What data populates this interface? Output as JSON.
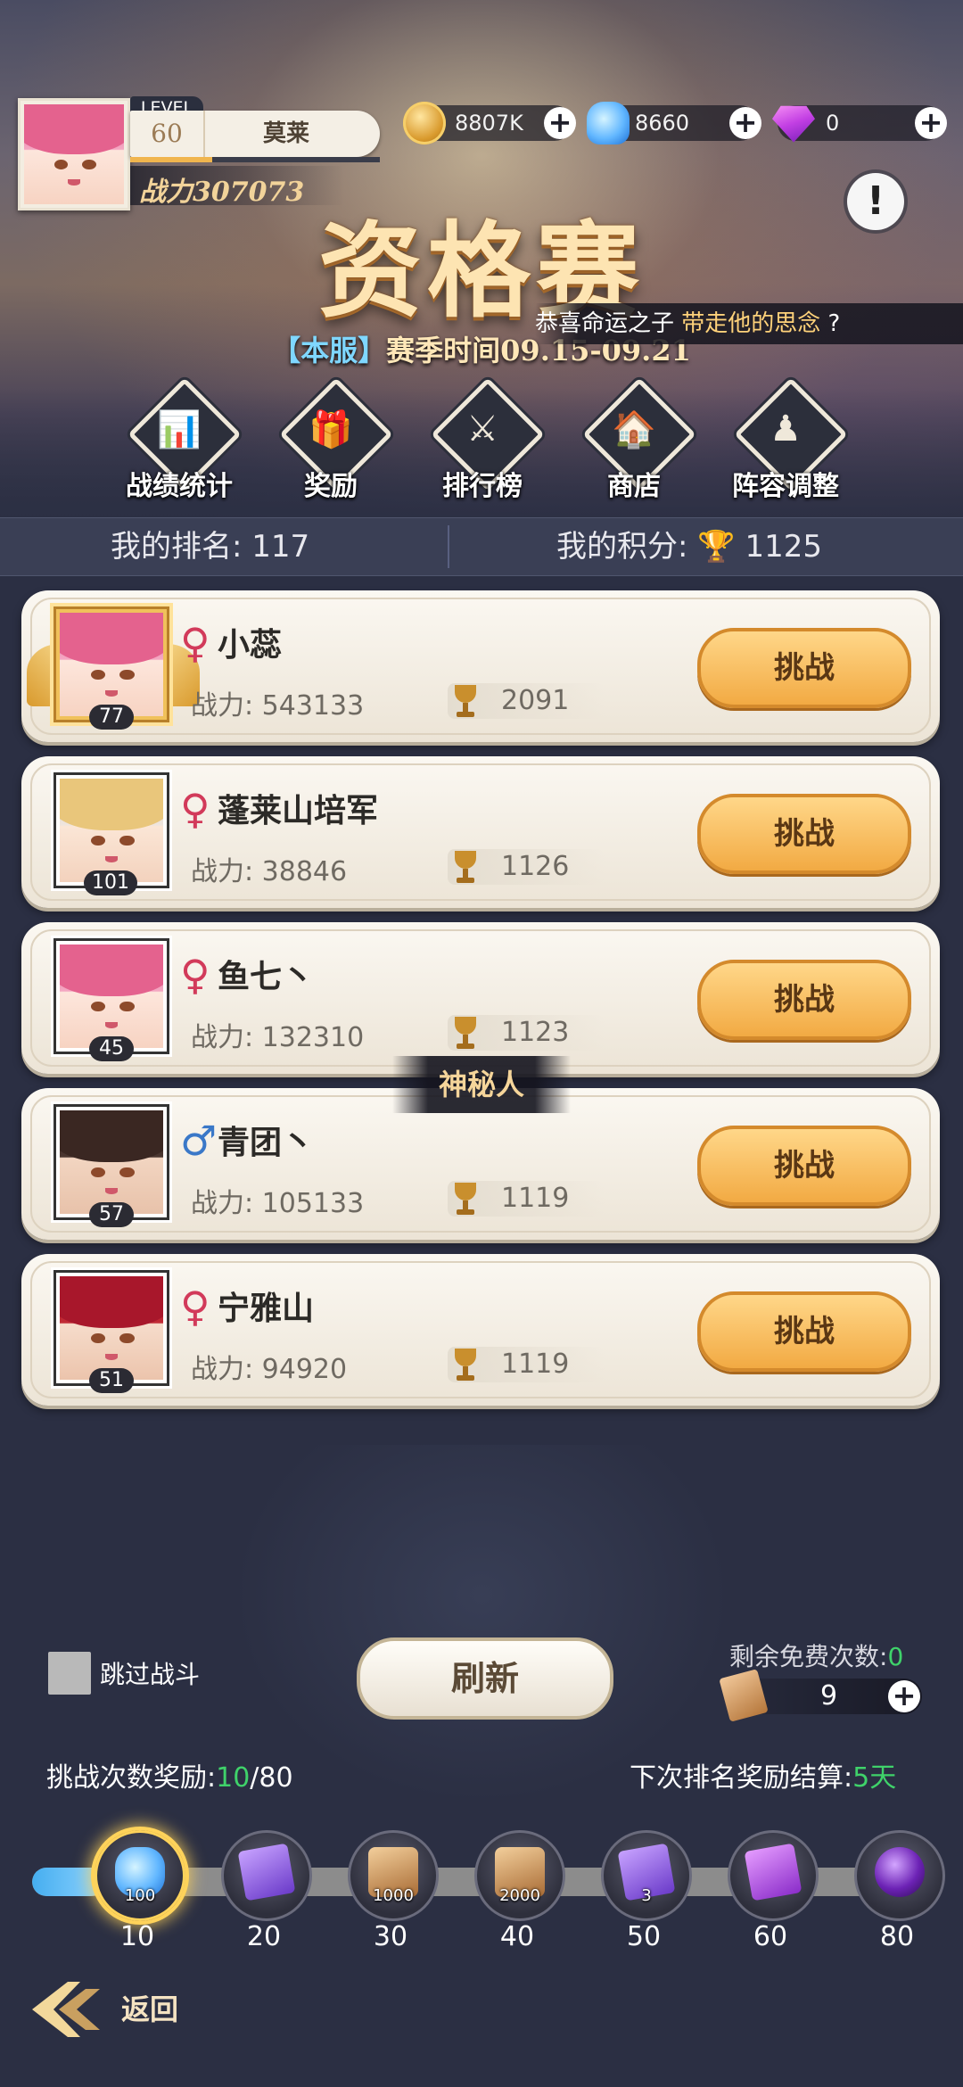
{
  "player": {
    "level_label": "LEVEL",
    "level": "60",
    "name": "莫莱",
    "exp_fraction": 0.33,
    "power": "战力307073"
  },
  "currencies": [
    {
      "icon": "gold-coin-icon",
      "value": "8807K"
    },
    {
      "icon": "blue-gem-icon",
      "value": "8660"
    },
    {
      "icon": "purple-diamond-icon",
      "value": "0"
    }
  ],
  "info_button": "!",
  "title": "资格赛",
  "season": {
    "tag": "【本服】",
    "text": "赛季时间09.15-09.21"
  },
  "marquee": {
    "prefix": "恭喜命运之子 ",
    "highlight": "带走他的思念 ",
    "suffix": "?"
  },
  "nav": [
    {
      "icon": "bar-chart-icon",
      "glyph": "📊",
      "label": "战绩统计"
    },
    {
      "icon": "gift-box-icon",
      "glyph": "🎁",
      "label": "奖励"
    },
    {
      "icon": "swords-icon",
      "glyph": "⚔",
      "label": "排行榜"
    },
    {
      "icon": "shop-icon",
      "glyph": "🏠",
      "label": "商店"
    },
    {
      "icon": "chess-pieces-icon",
      "glyph": "♟",
      "label": "阵容调整"
    }
  ],
  "rank": {
    "my_rank_label": "我的排名:",
    "my_rank": "117",
    "my_score_label": "我的积分:",
    "my_score": "1125"
  },
  "opponents": [
    {
      "gender": "♀",
      "gender_class": "f",
      "name": "小蕊",
      "power_label": "战力:",
      "power": "543133",
      "score": "2091",
      "level": "77",
      "button": "挑战"
    },
    {
      "gender": "♀",
      "gender_class": "f",
      "name": "蓬莱山培军",
      "power_label": "战力:",
      "power": "38846",
      "score": "1126",
      "level": "101",
      "button": "挑战"
    },
    {
      "gender": "♀",
      "gender_class": "f",
      "name": "鱼七丶",
      "power_label": "战力:",
      "power": "132310",
      "score": "1123",
      "level": "45",
      "button": "挑战"
    },
    {
      "gender": "♂",
      "gender_class": "m",
      "name": "青团丶",
      "power_label": "战力:",
      "power": "105133",
      "score": "1119",
      "level": "57",
      "button": "挑战"
    },
    {
      "gender": "♀",
      "gender_class": "f",
      "name": "宁雅山",
      "power_label": "战力:",
      "power": "94920",
      "score": "1119",
      "level": "51",
      "button": "挑战"
    }
  ],
  "mystery_label": "神秘人",
  "skip_battle_label": "跳过战斗",
  "refresh_label": "刷新",
  "free_refresh": {
    "label": "剩余免费次数:",
    "count": "0"
  },
  "tickets": {
    "icon": "scroll-ticket-icon",
    "count": "9"
  },
  "challenge_reward": {
    "label": "挑战次数奖励:",
    "current": "10",
    "total": "/80"
  },
  "next_settlement": {
    "label": "下次排名奖励结算:",
    "value": "5天"
  },
  "progress_fraction": 0.08,
  "rewards": [
    {
      "icon": "blue-gem-icon",
      "qty": "100",
      "milestone": "10",
      "active": true
    },
    {
      "icon": "winged-card-icon",
      "qty": "",
      "milestone": "20"
    },
    {
      "icon": "book-icon",
      "qty": "1000",
      "milestone": "30"
    },
    {
      "icon": "book-icon",
      "qty": "2000",
      "milestone": "40"
    },
    {
      "icon": "winged-card-icon",
      "qty": "3",
      "milestone": "50"
    },
    {
      "icon": "purple-card-icon",
      "qty": "",
      "milestone": "60"
    },
    {
      "icon": "purple-orb-icon",
      "qty": "",
      "milestone": "80"
    }
  ],
  "back_label": "返回"
}
